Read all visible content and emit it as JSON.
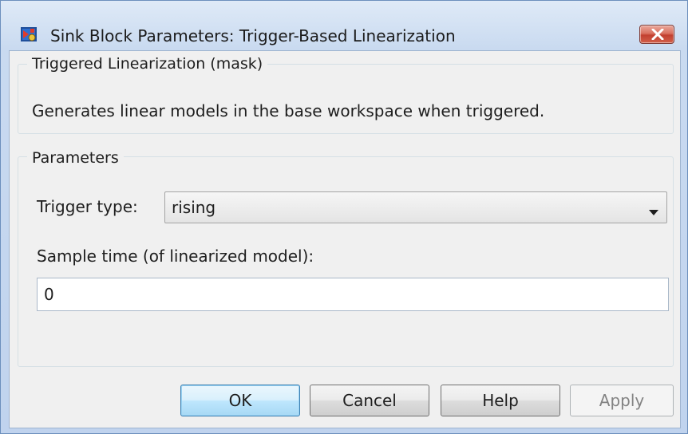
{
  "window": {
    "title": "Sink Block Parameters: Trigger-Based Linearization",
    "icon": "simulink-block-icon",
    "close_icon": "close-icon"
  },
  "description_group": {
    "title": "Triggered Linearization (mask)",
    "text": "Generates linear models in the base workspace when triggered."
  },
  "parameters_group": {
    "title": "Parameters",
    "trigger_type_label": "Trigger type:",
    "trigger_type_value": "rising",
    "sample_time_label": "Sample time (of linearized model):",
    "sample_time_value": "0"
  },
  "buttons": {
    "ok": "OK",
    "cancel": "Cancel",
    "help": "Help",
    "apply": "Apply"
  },
  "colors": {
    "close_button": "#c24030",
    "default_button_border": "#3c7fb1",
    "client_background": "#f0f0f0"
  }
}
